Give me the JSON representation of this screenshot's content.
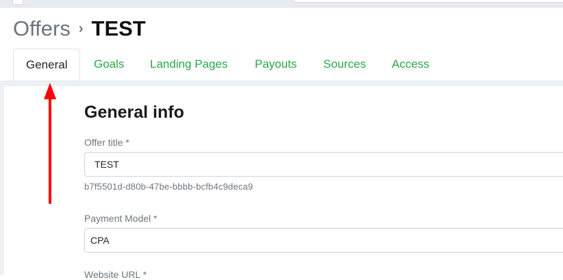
{
  "header": {
    "parent_crumb": "Offers",
    "separator": "›",
    "current_crumb": "TEST"
  },
  "tabs": [
    {
      "label": "General",
      "active": true
    },
    {
      "label": "Goals",
      "active": false
    },
    {
      "label": "Landing Pages",
      "active": false
    },
    {
      "label": "Payouts",
      "active": false
    },
    {
      "label": "Sources",
      "active": false
    },
    {
      "label": "Access",
      "active": false
    }
  ],
  "form": {
    "section_title": "General info",
    "offer_title": {
      "label": "Offer title *",
      "value": "TEST",
      "help": "b7f5501d-d80b-47be-bbbb-bcfb4c9deca9"
    },
    "payment_model": {
      "label": "Payment Model *",
      "value": "CPA"
    },
    "website_url": {
      "label": "Website URL *"
    }
  },
  "colors": {
    "tab_link": "#28a745",
    "annotation_arrow": "#ff0000"
  },
  "icons": {
    "annotation": "red-arrow-up-icon",
    "breadcrumb_separator": "chevron-right-icon"
  }
}
